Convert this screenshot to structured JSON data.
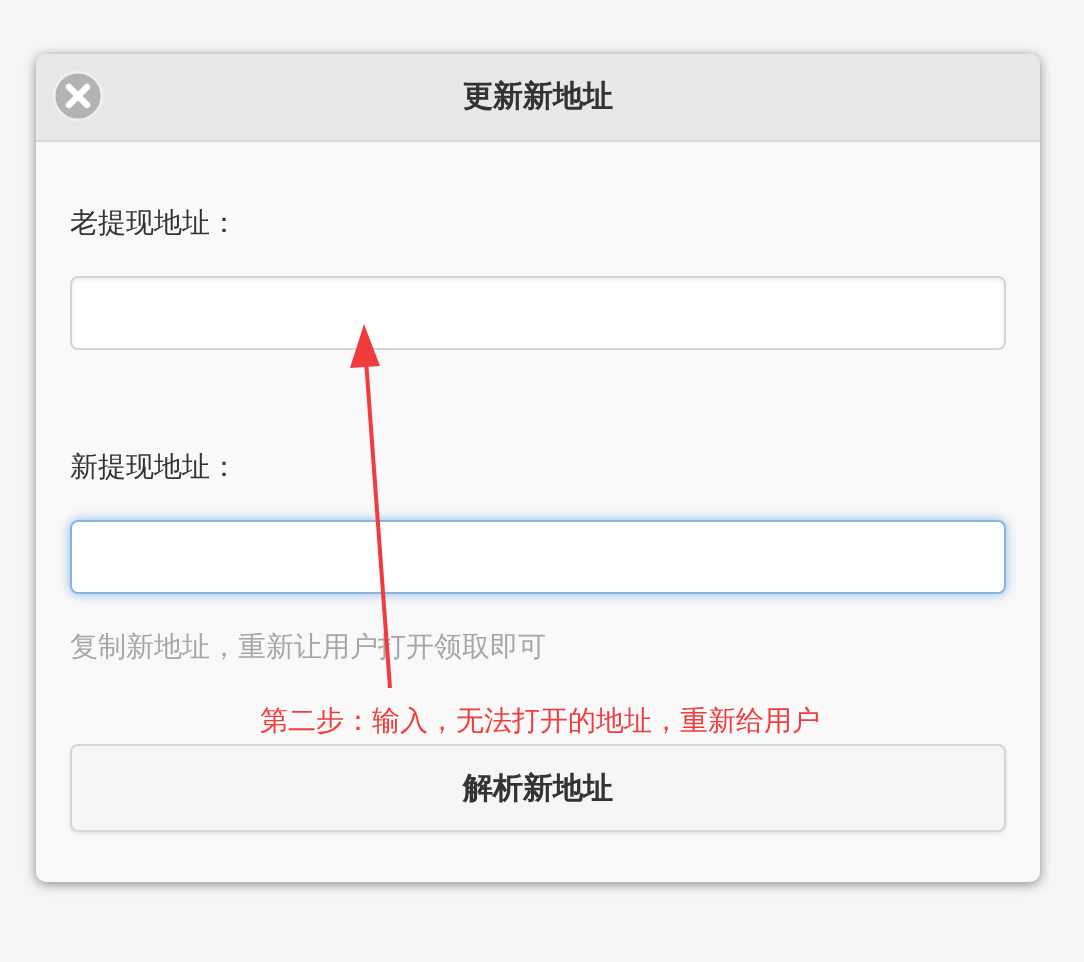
{
  "dialog": {
    "title": "更新新地址",
    "fields": [
      {
        "label": "老提现地址：",
        "focused": false
      },
      {
        "label": "新提现地址：",
        "focused": true
      }
    ],
    "hint": "复制新地址，重新让用户打开领取即可",
    "annotation": "第二步：输入，无法打开的地址，重新给用户",
    "button": "解析新地址"
  }
}
